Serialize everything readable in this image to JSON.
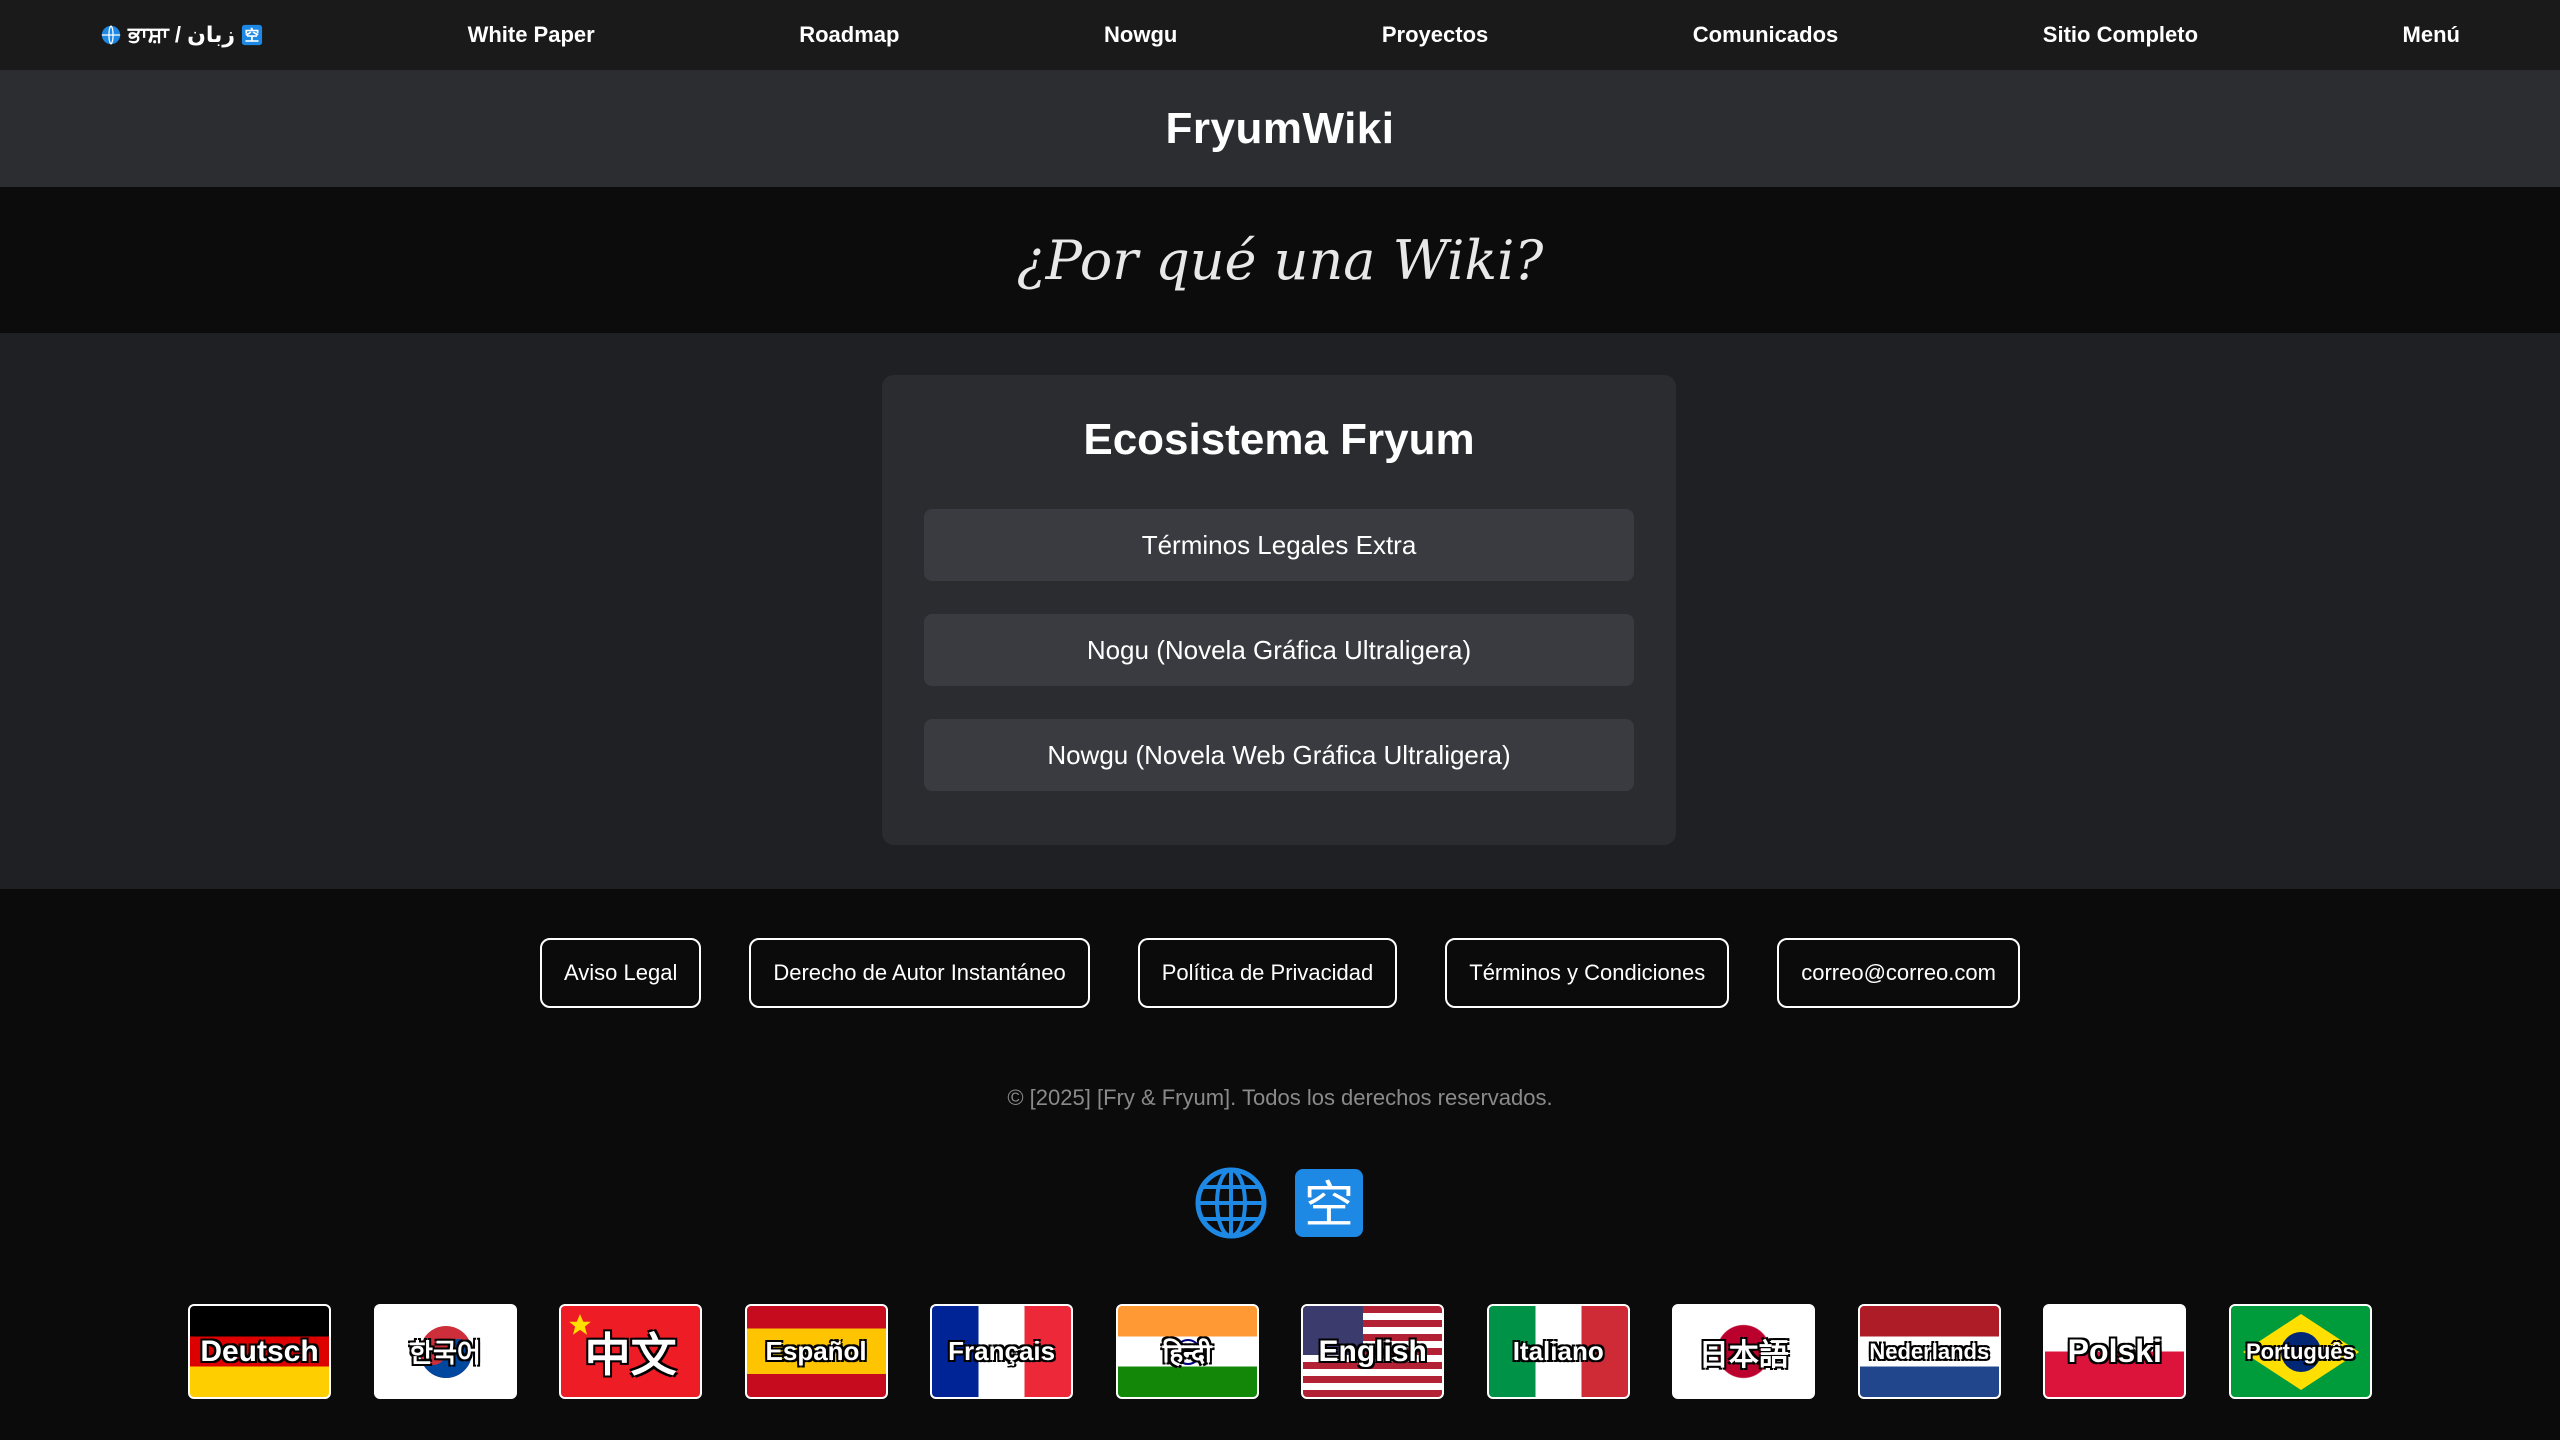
{
  "nav": {
    "lang_switch": "ਭਾਸ਼ਾ / زبان",
    "items": [
      {
        "label": "White Paper"
      },
      {
        "label": "Roadmap"
      },
      {
        "label": "Nowgu"
      },
      {
        "label": "Proyectos"
      },
      {
        "label": "Comunicados"
      },
      {
        "label": "Sitio Completo"
      },
      {
        "label": "Menú"
      }
    ]
  },
  "brand": {
    "title": "FryumWiki"
  },
  "hero": {
    "title": "¿Por qué una Wiki?"
  },
  "card": {
    "title": "Ecosistema Fryum",
    "buttons": [
      {
        "label": "Términos Legales Extra"
      },
      {
        "label": "Nogu (Novela Gráfica Ultraligera)"
      },
      {
        "label": "Nowgu (Novela Web Gráfica Ultraligera)"
      }
    ]
  },
  "footer": {
    "links": [
      {
        "label": "Aviso Legal"
      },
      {
        "label": "Derecho de Autor Instantáneo"
      },
      {
        "label": "Política de Privacidad"
      },
      {
        "label": "Términos y Condiciones"
      },
      {
        "label": "correo@correo.com"
      }
    ],
    "copyright": "© [2025] [Fry & Fryum]. Todos los derechos reservados.",
    "icons": {
      "globe": "globe-icon",
      "kanji": "空"
    },
    "flags": [
      {
        "label": "Deutsch"
      },
      {
        "label": "한국어"
      },
      {
        "label": "中文"
      },
      {
        "label": "Español"
      },
      {
        "label": "Français"
      },
      {
        "label": "हिन्दी"
      },
      {
        "label": "English"
      },
      {
        "label": "Italiano"
      },
      {
        "label": "日本語"
      },
      {
        "label": "Nederlands"
      },
      {
        "label": "Polski"
      },
      {
        "label": "Português"
      }
    ]
  },
  "colors": {
    "accent_blue": "#1e88e5",
    "nav_bg": "#1a1a1a",
    "brand_bg": "#2b2d31"
  }
}
